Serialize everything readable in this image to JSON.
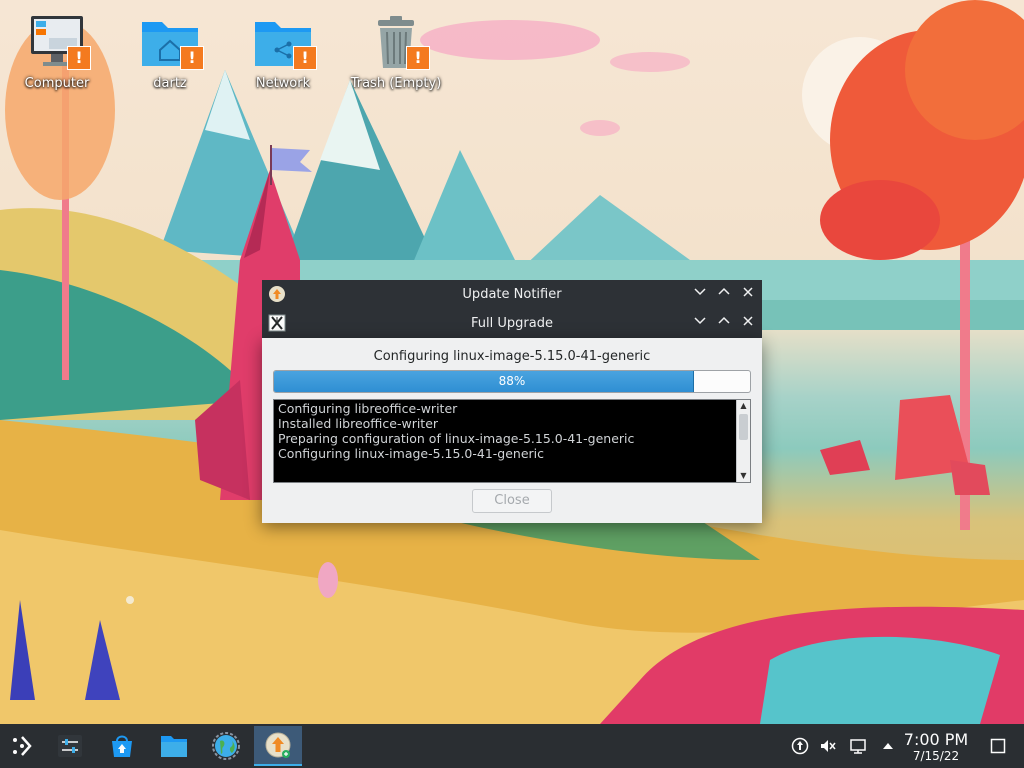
{
  "desktop": {
    "icons": [
      {
        "label": "Computer"
      },
      {
        "label": "dartz"
      },
      {
        "label": "Network"
      },
      {
        "label": "Trash (Empty)"
      }
    ],
    "badge": "!"
  },
  "update_notifier": {
    "title": "Update Notifier"
  },
  "full_upgrade": {
    "title": "Full Upgrade",
    "status": "Configuring linux-image-5.15.0-41-generic",
    "progress_label": "88%",
    "progress": 0.88,
    "log": [
      "Configuring libreoffice-writer",
      "Installed libreoffice-writer",
      "Preparing configuration of linux-image-5.15.0-41-generic",
      "Configuring linux-image-5.15.0-41-generic"
    ],
    "close_label": "Close",
    "close_enabled": false
  },
  "window_controls": {
    "minimize": "﹀",
    "maximize": "︿",
    "close": "✕"
  },
  "taskbar": {
    "items": [
      {
        "icon": "application-launcher-icon"
      },
      {
        "icon": "system-settings-icon"
      },
      {
        "icon": "discover-store-icon"
      },
      {
        "icon": "file-manager-icon"
      },
      {
        "icon": "web-browser-icon"
      },
      {
        "icon": "update-notifier-icon"
      }
    ],
    "tray": [
      {
        "icon": "updates-tray-icon"
      },
      {
        "icon": "volume-muted-icon"
      },
      {
        "icon": "network-wired-icon"
      },
      {
        "icon": "expand-tray-arrow-icon"
      }
    ],
    "clock": {
      "time": "7:00 PM",
      "date": "7/15/22"
    }
  },
  "colors": {
    "accent": "#3daee9",
    "titlebar": "#2d3136",
    "taskbar": "#2a2e32",
    "warning": "#f47a1f"
  }
}
